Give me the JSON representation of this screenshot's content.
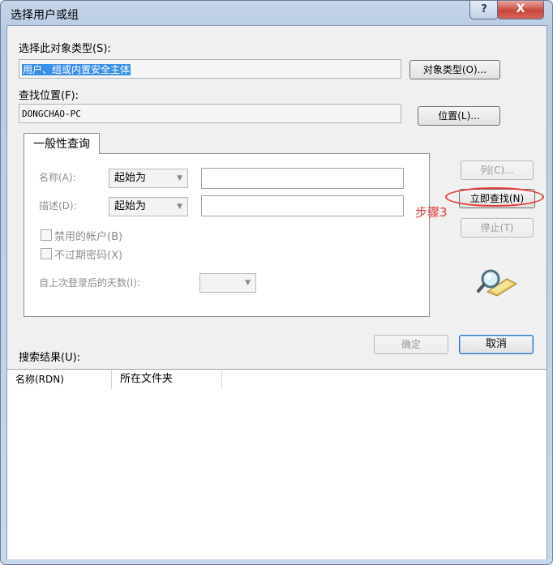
{
  "window": {
    "title": "选择用户或组",
    "help_glyph": "?",
    "close_glyph": "X"
  },
  "object_type": {
    "label": "选择此对象类型(S):",
    "value": "用户、组或内置安全主体",
    "button": "对象类型(O)..."
  },
  "location": {
    "label": "查找位置(F):",
    "value": "DONGCHAO-PC",
    "button": "位置(L)..."
  },
  "query": {
    "tab_label": "一般性查询",
    "name_label": "名称(A):",
    "name_mode": "起始为",
    "name_value": "",
    "desc_label": "描述(D):",
    "desc_mode": "起始为",
    "desc_value": "",
    "disabled_accounts": "禁用的帐户(B)",
    "non_expiring_pw": "不过期密码(X)",
    "days_label": "自上次登录后的天数(I):",
    "days_value": ""
  },
  "side_buttons": {
    "columns": "列(C)...",
    "find_now": "立即查找(N)",
    "stop": "停止(T)"
  },
  "annotation": {
    "step": "步骤3",
    "color": "#e23b36"
  },
  "icons": {
    "search": "magnifier-icon"
  },
  "actions": {
    "ok": "确定",
    "cancel": "取消"
  },
  "results": {
    "label": "搜索结果(U):",
    "columns": [
      "名称(RDN)",
      "所在文件夹"
    ],
    "rows": []
  }
}
